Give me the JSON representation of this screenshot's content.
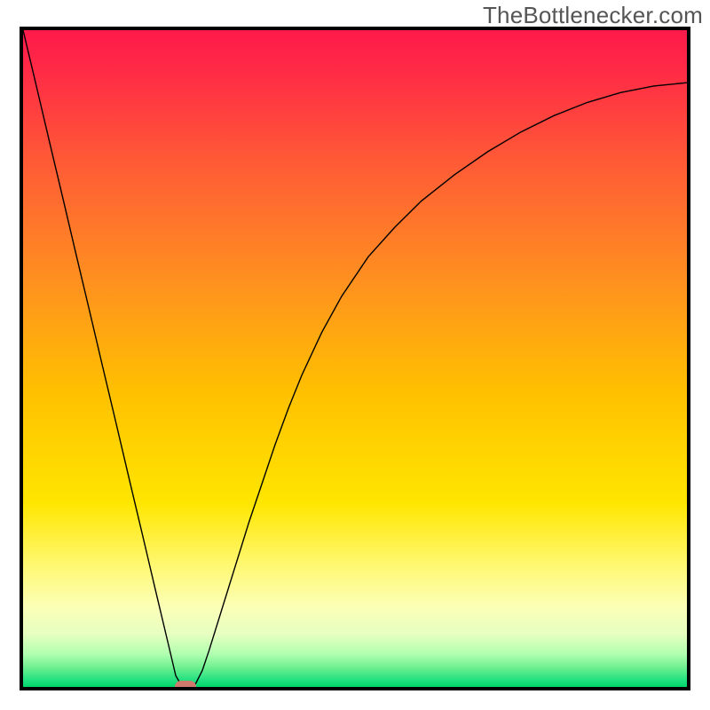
{
  "watermark": "TheBottlenecker.com",
  "chart_data": {
    "type": "line",
    "title": "",
    "xlabel": "",
    "ylabel": "",
    "xlim": [
      0,
      100
    ],
    "ylim": [
      0,
      100
    ],
    "background_gradient": {
      "top": "#ff1a4a",
      "yellow": "#ffd400",
      "bottom": "#00d66b"
    },
    "series": [
      {
        "name": "bottleneck-curve",
        "x": [
          0,
          2,
          4,
          6,
          8,
          10,
          12,
          14,
          16,
          18,
          20,
          22,
          23,
          24,
          25,
          26,
          27,
          28,
          30,
          32,
          34,
          36,
          38,
          40,
          42,
          45,
          48,
          52,
          56,
          60,
          65,
          70,
          75,
          80,
          85,
          90,
          95,
          100
        ],
        "y": [
          100,
          91.5,
          82.9,
          74.4,
          65.8,
          57.3,
          48.7,
          40.2,
          31.6,
          23.1,
          14.5,
          6.0,
          1.7,
          0.0,
          0.0,
          0.5,
          2.5,
          5.5,
          12.0,
          18.5,
          25.0,
          31.0,
          37.0,
          42.5,
          47.5,
          54.0,
          59.5,
          65.5,
          70.0,
          74.0,
          78.0,
          81.5,
          84.5,
          87.0,
          89.0,
          90.5,
          91.5,
          92.0
        ]
      }
    ],
    "marker": {
      "name": "minimum-marker",
      "x": 24.5,
      "y": 0,
      "color": "#d07a6e"
    }
  }
}
